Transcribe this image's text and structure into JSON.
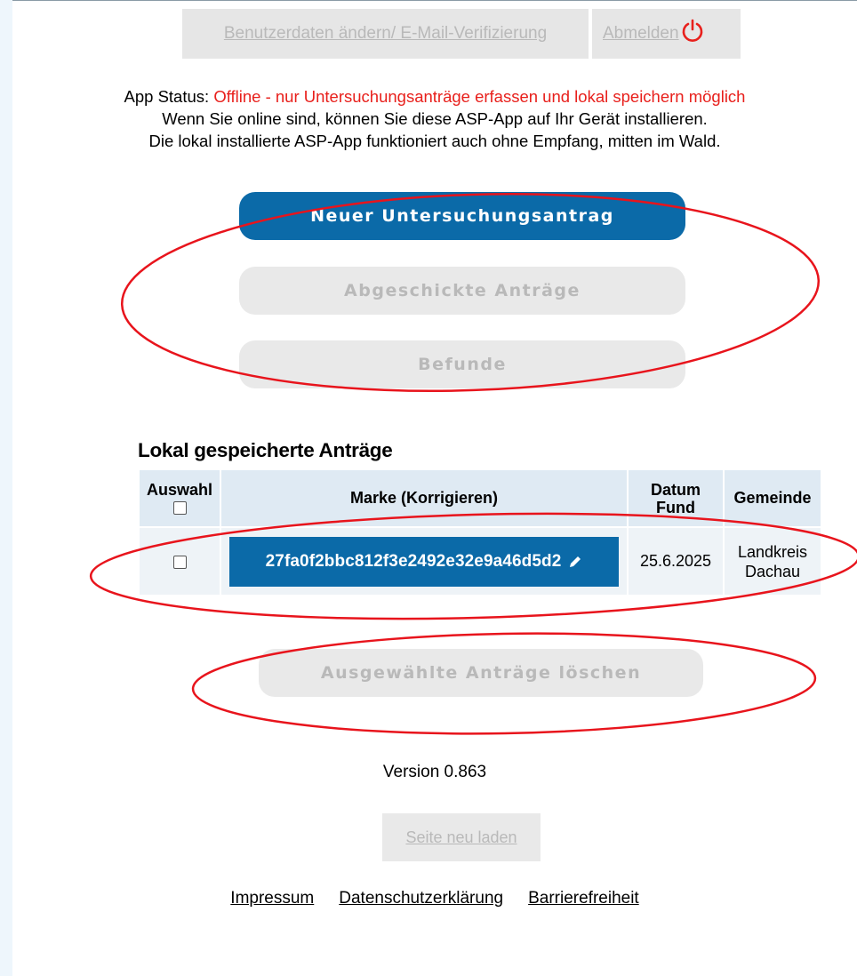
{
  "topnav": {
    "edit_label": "Benutzerdaten ändern/ E-Mail-Verifizierung",
    "logout_label": "Abmelden"
  },
  "status": {
    "prefix": "App Status: ",
    "offline_text": "Offline - nur Untersuchungsanträge erfassen und lokal speichern möglich",
    "line2": "Wenn Sie online sind, können Sie diese ASP-App auf Ihr Gerät installieren.",
    "line3": "Die lokal installierte ASP-App funktioniert auch ohne Empfang, mitten im Wald."
  },
  "actions": {
    "new_request": "Neuer Untersuchungsantrag",
    "sent_requests": "Abgeschickte Anträge",
    "results": "Befunde"
  },
  "saved": {
    "title": "Lokal gespeicherte Anträge",
    "headers": {
      "select": "Auswahl",
      "marke": "Marke (Korrigieren)",
      "datum_1": "Datum",
      "datum_2": "Fund",
      "gemeinde": "Gemeinde"
    },
    "rows": [
      {
        "marke": "27fa0f2bbc812f3e2492e32e9a46d5d2",
        "datum": "25.6.2025",
        "gemeinde_1": "Landkreis",
        "gemeinde_2": "Dachau"
      }
    ],
    "delete_label": "Ausgewählte Anträge löschen"
  },
  "version": "Version 0.863",
  "reload_label": "Seite neu laden",
  "footer": {
    "impressum": "Impressum",
    "datenschutz": "Datenschutzerklärung",
    "barrierefreiheit": "Barrierefreiheit"
  },
  "colors": {
    "primary": "#0b6aa8",
    "offline": "#e8201c",
    "annotation": "#e8141c",
    "disabled_bg": "#e9e9e9",
    "disabled_text": "#b9b9b9"
  },
  "icons": {
    "logout": "power-icon",
    "edit": "pencil-icon"
  }
}
